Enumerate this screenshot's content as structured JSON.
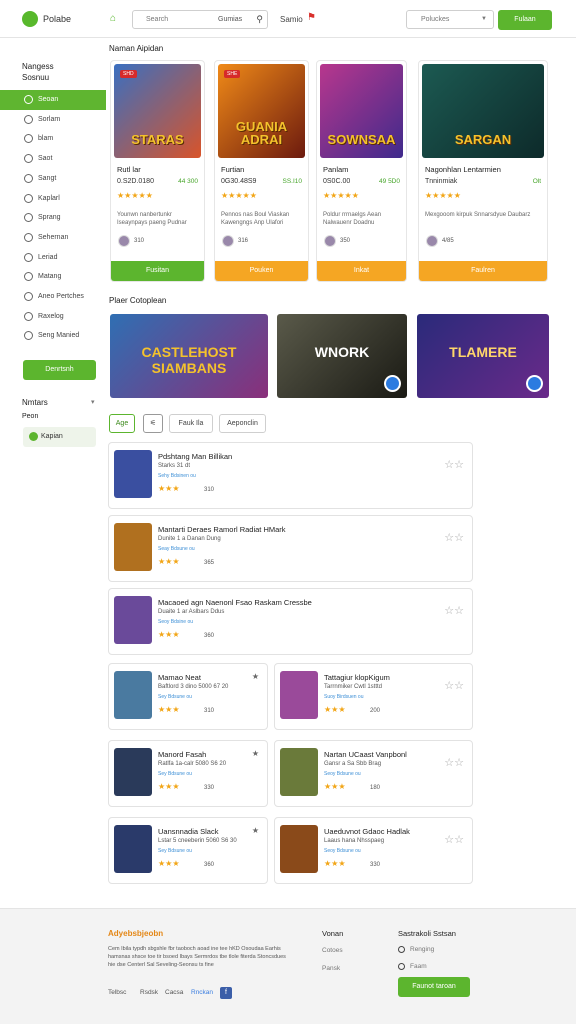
{
  "header": {
    "logo_text": "Polabe",
    "home_icon": "home-icon",
    "search_placeholder": "Search",
    "search_category": "Gumias",
    "nav_label": "Samio",
    "cart_icon": "bell-icon",
    "select_placeholder": "Poluckes",
    "login_label": "Fulaan"
  },
  "sidebar": {
    "heading1": "Nangess",
    "heading2": "Sosnuu",
    "items": [
      {
        "label": "Seoan",
        "icon": "home-icon",
        "active": true
      },
      {
        "label": "Sorlam",
        "icon": "search-icon"
      },
      {
        "label": "blam",
        "icon": "globe-icon"
      },
      {
        "label": "Saot",
        "icon": "info-icon"
      },
      {
        "label": "Sangt",
        "icon": "clock-icon"
      },
      {
        "label": "Kaplarl",
        "icon": "arrow-icon"
      },
      {
        "label": "Sprang",
        "icon": "grid-icon"
      },
      {
        "label": "Sehernan",
        "icon": "calendar-icon"
      },
      {
        "label": "Leriad",
        "icon": "doc-icon"
      },
      {
        "label": "Matang",
        "icon": "monitor-icon"
      },
      {
        "label": "Aneo Pertches",
        "icon": "circle-icon"
      },
      {
        "label": "Raxelog",
        "icon": "lock-icon"
      },
      {
        "label": "Seng Manied",
        "icon": "settings-icon"
      }
    ],
    "cta_label": "Denrtsnh",
    "heading3": "Nmtars",
    "heading4": "Peon",
    "badge_label": "Kapian"
  },
  "section1": {
    "title": "Naman Aipidan"
  },
  "cards": [
    {
      "badge": "SHD",
      "art": "STARAS",
      "name": "Rutl lar",
      "price": "0.S2D.0180",
      "price_alt": "44 300",
      "stars": "★★★★★",
      "desc": "Younwn nanbertunkr Iseaynpays paeng Pudnar",
      "count": "310",
      "button": "Fusitan",
      "color": "#5cb52e"
    },
    {
      "badge": "SHE",
      "art": "GUANIA ADRAI",
      "name": "Furtian",
      "price": "0G30.48S9",
      "price_alt": "SS.I10",
      "stars": "★★★★★",
      "desc": "Pennos nas Boul Viaskan Kawengngs Anp Ulafori",
      "count": "316",
      "button": "Pouken",
      "color": "#f5a623"
    },
    {
      "badge": "",
      "art": "SOWNSAA",
      "name": "Panlam",
      "price": "0S0C.00",
      "price_alt": "49 5D0",
      "stars": "★★★★★",
      "desc": "Poldur rrrnaelgs Aean Nalwauenr Doadnu",
      "count": "350",
      "button": "Inkat",
      "color": "#f5a623"
    },
    {
      "badge": "",
      "art": "SARGAN",
      "name": "Nagonhlan Lentarmien",
      "price": "Tnninmiak",
      "price_alt": "Olt",
      "stars": "★★★★★",
      "desc": "Mexgooom kirpuk Snnarsdyue Daubarz",
      "count": "4/85",
      "button": "Faulren",
      "color": "#f5a623"
    }
  ],
  "section2": {
    "title": "Plaer Cotoplean"
  },
  "featured": [
    {
      "art": "CASTLEHOST SIAMBANS",
      "footer_icon": ""
    },
    {
      "art": "WNORK",
      "footer_icon": "share-icon"
    },
    {
      "art": "TLAMERE",
      "footer_icon": "share-icon"
    }
  ],
  "chips": [
    "Age",
    "Fauk Ila",
    "Aeponclin"
  ],
  "chip_icon": "filter-icon",
  "rows_full": [
    {
      "title": "Pdshtang Man Billikan",
      "sub": "Starks 31 dt",
      "tag": "Sehy Bdsinen ou",
      "stars": "★★★",
      "rating": "310"
    },
    {
      "title": "Mantarti Deraes Ramorl Radiat HMark",
      "sub": "Dunite 1 a Danan Dung",
      "tag": "Seay Bdsune ou",
      "stars": "★★★",
      "rating": "365"
    },
    {
      "title": "Macaoed agn Naenonl Fsao Raskam Cressbe",
      "sub": "Duaite 1 ar Aslbars Ddus",
      "tag": "Seoy Bdsine ou",
      "stars": "★★★",
      "rating": "360"
    }
  ],
  "rows_half": [
    {
      "title": "Mamao Neat",
      "sub": "Baftlord 3 dino 5000 67 20",
      "tag": "Sey Bdsune ou",
      "stars": "★★★",
      "rating": "310"
    },
    {
      "title": "Tattagiur klopKigum",
      "sub": "Tarrnmiker Cwtl 1stttd",
      "tag": "Suoy Birdsuen ou",
      "stars": "★★★",
      "rating": "200"
    },
    {
      "title": "Manord Fasah",
      "sub": "Ratlfa 1a-calr 5080 S6 20",
      "tag": "Sey Bdsune ou",
      "stars": "★★★",
      "rating": "330"
    },
    {
      "title": "Nartan UCaast Vanpbonl",
      "sub": "Gansr a Sa Sbb Brag",
      "tag": "Seoy Bdsune ou",
      "stars": "★★★",
      "rating": "180"
    },
    {
      "title": "Uansnnadia Slack",
      "sub": "Lstar 5 cneeberin 5060 S6 30",
      "tag": "Sey Bdsune ou",
      "stars": "★★★",
      "rating": "360"
    },
    {
      "title": "Uaeduvnot Gdaoc Hadlak",
      "sub": "Laaus hana Nhsspaeg",
      "tag": "Seoy Bdsune ou",
      "stars": "★★★",
      "rating": "330"
    }
  ],
  "footer": {
    "about_title": "Adyebsbjeobn",
    "about_desc": "Cem Ibila typdh sbgshle fbr taoboch aoad ine tee hKD Osoudaa Earhis hamsnas shsce toe tir bsoed Ibays Sermrdos tbe tlole fiterda Stoncsdues hie dse Centerl Sal Seveling-Seonsu ts fine",
    "links": [
      "Telbsc",
      "Rsdsk",
      "Cacsa",
      "Rnckan"
    ],
    "col2_title": "Vonan",
    "col2_links": [
      "Cotoes",
      "Pansk"
    ],
    "col3_title": "Sastrakoli Sstsan",
    "col3_options": [
      "Renging",
      "Faam"
    ],
    "button": "Faunot taroan",
    "fb_icon": "facebook-icon"
  }
}
